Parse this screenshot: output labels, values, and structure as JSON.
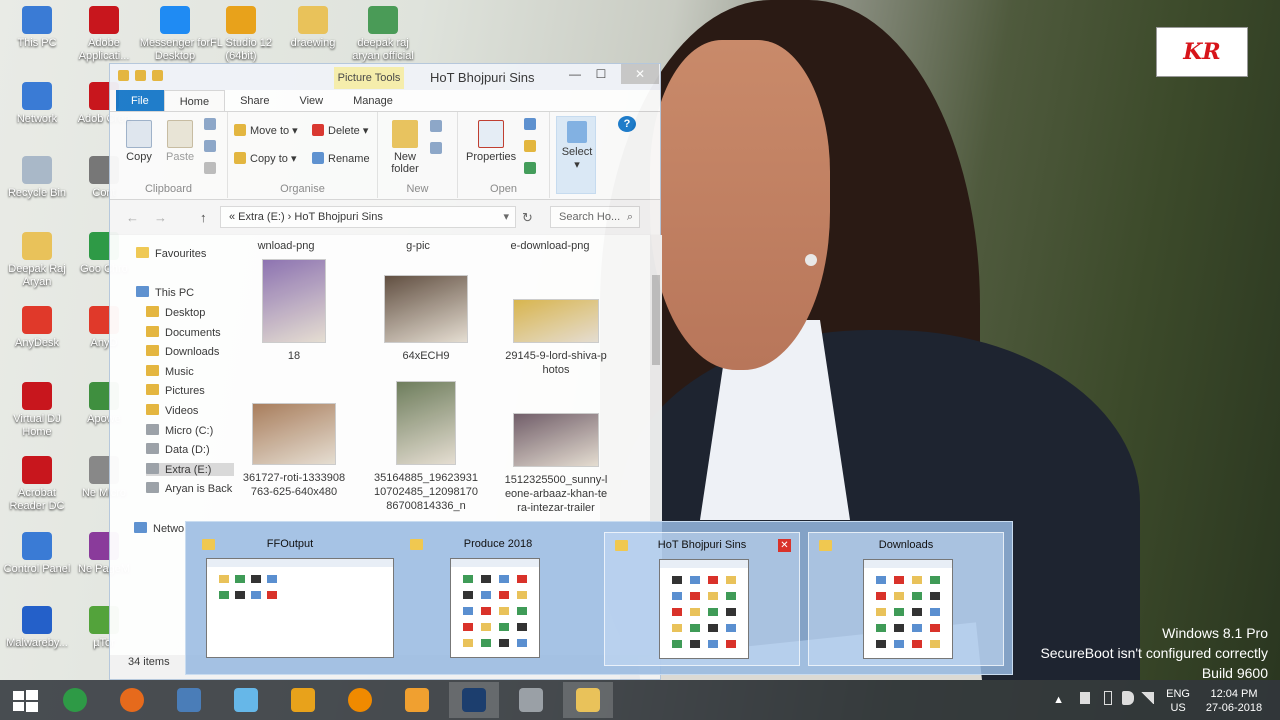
{
  "desktop_icons": [
    {
      "label": "This PC",
      "color": "#3a7bd5"
    },
    {
      "label": "Adobe Applicati...",
      "color": "#c8161d"
    },
    {
      "label": "Messenger for Desktop",
      "color": "#1f8bf3"
    },
    {
      "label": "FL Studio 12 (64bit)",
      "color": "#e8a21b"
    },
    {
      "label": "draewing",
      "color": "#e9c25a"
    },
    {
      "label": "deepak raj aryan official",
      "color": "#4a9b57"
    },
    {
      "label": "Network",
      "color": "#3a7bd5"
    },
    {
      "label": "Adob Crea",
      "color": "#c8161d"
    },
    {
      "label": "Recycle Bin",
      "color": "#a9b8c8"
    },
    {
      "label": "Cont",
      "color": "#777"
    },
    {
      "label": "Deepak Raj Aryan",
      "color": "#e9c25a"
    },
    {
      "label": "Goo Chro",
      "color": "#2e9a46"
    },
    {
      "label": "AnyDesk",
      "color": "#e0392a"
    },
    {
      "label": "AnyD",
      "color": "#e0392a"
    },
    {
      "label": "Virtual DJ Home",
      "color": "#c8161d"
    },
    {
      "label": "Apowe",
      "color": "#3f8f3f"
    },
    {
      "label": "Acrobat Reader DC",
      "color": "#c8161d"
    },
    {
      "label": "Ne Micro",
      "color": "#888"
    },
    {
      "label": "Control Panel",
      "color": "#3a7bd5"
    },
    {
      "label": "Ne PageM",
      "color": "#8a3b9b"
    },
    {
      "label": "Malwareby...",
      "color": "#2460c9"
    },
    {
      "label": "µTor",
      "color": "#53a33b"
    }
  ],
  "logo": {
    "text": "KR"
  },
  "explorer": {
    "title": "HoT Bhojpuri Sins",
    "picture_tools": "Picture Tools",
    "window_buttons": {
      "minimize": "—",
      "maximize": "☐",
      "close": "✕"
    },
    "tabs": [
      "File",
      "Home",
      "Share",
      "View",
      "Manage"
    ],
    "ribbon": {
      "copy": "Copy",
      "paste": "Paste",
      "clipboard": "Clipboard",
      "move_to": "Move to ▾",
      "copy_to": "Copy to ▾",
      "delete": "Delete ▾",
      "rename": "Rename",
      "organise": "Organise",
      "new_folder": "New folder",
      "new": "New",
      "properties": "Properties",
      "open": "Open",
      "select": "Select",
      "select_arrow": "▾"
    },
    "address": {
      "path": "«  Extra (E:)  ›  HoT Bhojpuri Sins",
      "search_placeholder": "Search Ho...",
      "back": "←",
      "forward": "→",
      "up": "↑",
      "refresh": "↻",
      "dropdown": "▾",
      "search_icon": "⌕"
    },
    "nav": {
      "favourites": "Favourites",
      "this_pc": "This PC",
      "items": [
        "Desktop",
        "Documents",
        "Downloads",
        "Music",
        "Pictures",
        "Videos",
        "Micro (C:)",
        "Data (D:)",
        "Extra (E:)",
        "Aryan is Back"
      ],
      "network": "Netwo"
    },
    "files_top": [
      "wnload-png",
      "g-pic",
      "e-download-png"
    ],
    "files": [
      {
        "name": "18",
        "color": "#8a6fb0"
      },
      {
        "name": "64xECH9",
        "color": "#5d4a3c"
      },
      {
        "name": "29145-9-lord-shiva-photos",
        "color": "#d9b44a"
      },
      {
        "name": "361727-roti-1333908763-625-640x480",
        "color": "#a77a58"
      },
      {
        "name": "35164885_1962393110702485_1209817086700814336_n",
        "color": "#6a7a58"
      },
      {
        "name": "1512325500_sunny-leone-arbaaz-khan-tera-intezar-trailer",
        "color": "#6e5a66"
      }
    ],
    "status": "34 items"
  },
  "previews": [
    {
      "title": "FFOutput",
      "highlight": false,
      "close": ""
    },
    {
      "title": "Produce 2018",
      "highlight": false,
      "close": ""
    },
    {
      "title": "HoT Bhojpuri Sins",
      "highlight": true,
      "close": "✕"
    },
    {
      "title": "Downloads",
      "highlight": true,
      "close": ""
    }
  ],
  "watermark": [
    "Windows 8.1 Pro",
    "SecureBoot isn't configured correctly",
    "Build 9600"
  ],
  "taskbar": {
    "apps": [
      {
        "name": "chrome-icon",
        "color": "#2e9a46"
      },
      {
        "name": "firefox-icon",
        "color": "#e66a1c"
      },
      {
        "name": "network-icon",
        "color": "#4a7db8"
      },
      {
        "name": "notepad-icon",
        "color": "#66b7e8"
      },
      {
        "name": "fl-studio-icon",
        "color": "#e8a21b"
      },
      {
        "name": "vlc-icon",
        "color": "#f08a00"
      },
      {
        "name": "uc-browser-icon",
        "color": "#f0a030"
      },
      {
        "name": "photoshop-icon",
        "color": "#1c3e6e"
      },
      {
        "name": "xampp-icon",
        "color": "#9aa0a6"
      },
      {
        "name": "explorer-icon",
        "color": "#e9c25a"
      }
    ],
    "lang": "ENG",
    "region": "US",
    "time": "12:04 PM",
    "date": "27-06-2018",
    "tray_arrow": "▲"
  }
}
